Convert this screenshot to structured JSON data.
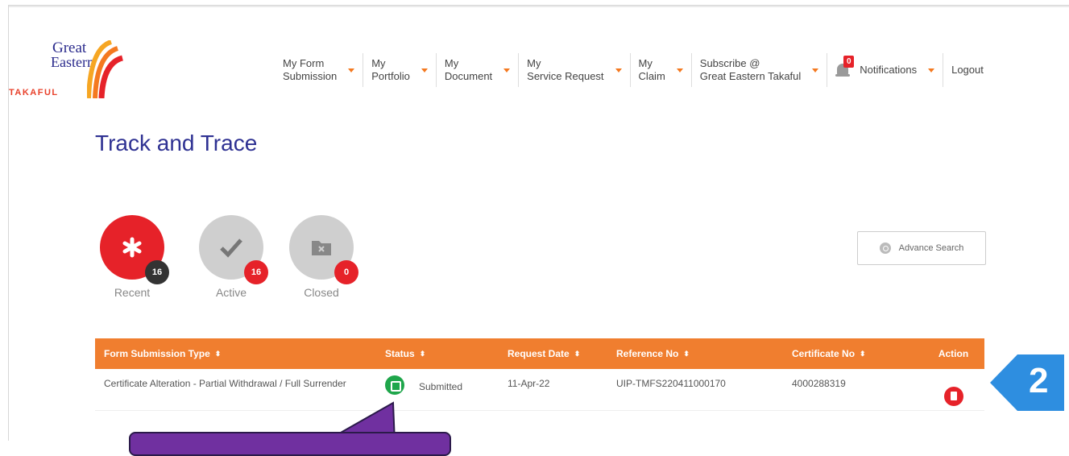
{
  "logo": {
    "line1": "Great",
    "line2": "Eastern",
    "line3": "TAKAFUL"
  },
  "nav": {
    "items": [
      {
        "label_line1": "My Form",
        "label_line2": "Submission"
      },
      {
        "label_line1": "My",
        "label_line2": "Portfolio"
      },
      {
        "label_line1": "My",
        "label_line2": "Document"
      },
      {
        "label_line1": "My",
        "label_line2": "Service Request"
      },
      {
        "label_line1": "My",
        "label_line2": "Claim"
      },
      {
        "label_line1": "Subscribe @",
        "label_line2": "Great Eastern Takaful"
      }
    ],
    "notifications_label": "Notifications",
    "notifications_count": "0",
    "logout_label": "Logout"
  },
  "page": {
    "title": "Track and Trace"
  },
  "stats": [
    {
      "label": "Recent",
      "count": "16",
      "circle_color": "#e62229",
      "badge_color": "#333333",
      "icon": "asterisk-icon"
    },
    {
      "label": "Active",
      "count": "16",
      "circle_color": "#cfcfcf",
      "badge_color": "#e62229",
      "icon": "checkmark-icon"
    },
    {
      "label": "Closed",
      "count": "0",
      "circle_color": "#cfcfcf",
      "badge_color": "#e62229",
      "icon": "folder-x-icon"
    }
  ],
  "advance_search": {
    "label": "Advance Search"
  },
  "table": {
    "headers": [
      "Form Submission Type",
      "Status",
      "Request Date",
      "Reference No",
      "Certificate No",
      "Action"
    ],
    "sort_glyph": "⬍",
    "rows": [
      {
        "type": "Certificate Alteration - Partial Withdrawal / Full Surrender",
        "status": "Submitted",
        "request_date": "11-Apr-22",
        "reference_no": "UIP-TMFS220411000170",
        "certificate_no": "4000288319"
      }
    ]
  },
  "callout": {
    "number": "2",
    "color": "#2e8ee0"
  },
  "colors": {
    "accent": "#f07e2f",
    "title": "#2e3192",
    "purple_callout": "#7030a0"
  }
}
